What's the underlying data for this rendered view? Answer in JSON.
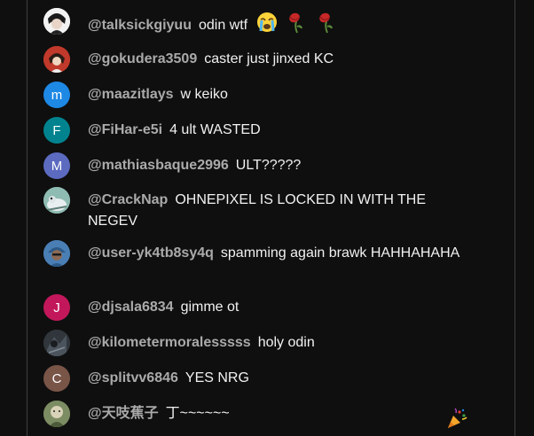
{
  "colors": {
    "background": "#0f0f0f",
    "author": "#aaaaaa",
    "message": "#f1f1f1",
    "avatar_m_blue": "#1e88e5",
    "avatar_f_teal": "#00838f",
    "avatar_m_purple": "#5c6bc0",
    "avatar_j_pink": "#c2185b",
    "avatar_c_brown": "#795548"
  },
  "chat": {
    "messages": [
      {
        "author": "@talksickgiyuu",
        "text": "odin wtf",
        "emojis": [
          "loudly-crying-face-icon",
          "wilted-flower-icon",
          "wilted-flower-icon"
        ]
      },
      {
        "author": "@gokudera3509",
        "text": "caster just jinxed KC"
      },
      {
        "author": "@maazitlays",
        "text": "w keiko",
        "avatar_letter": "m"
      },
      {
        "author": "@FiHar-e5i",
        "text": "4 ult WASTED",
        "avatar_letter": "F"
      },
      {
        "author": "@mathiasbaque2996",
        "text": "ULT?????",
        "avatar_letter": "M"
      },
      {
        "author": "@CrackNap",
        "text": "OHNEPIXEL IS LOCKED IN WITH THE NEGEV"
      },
      {
        "author": "@user-yk4tb8sy4q",
        "text": "spamming again brawk HAHHAHAHA"
      },
      {
        "author": "@djsala6834",
        "text": "gimme ot",
        "avatar_letter": "J"
      },
      {
        "author": "@kilometermoralesssss",
        "text": "holy odin"
      },
      {
        "author": "@splitvv6846",
        "text": "YES NRG",
        "avatar_letter": "C"
      },
      {
        "author": "@天吱蕉子",
        "text": "丁~~~~~~",
        "emojis": [
          "party-popper-icon"
        ]
      }
    ]
  }
}
